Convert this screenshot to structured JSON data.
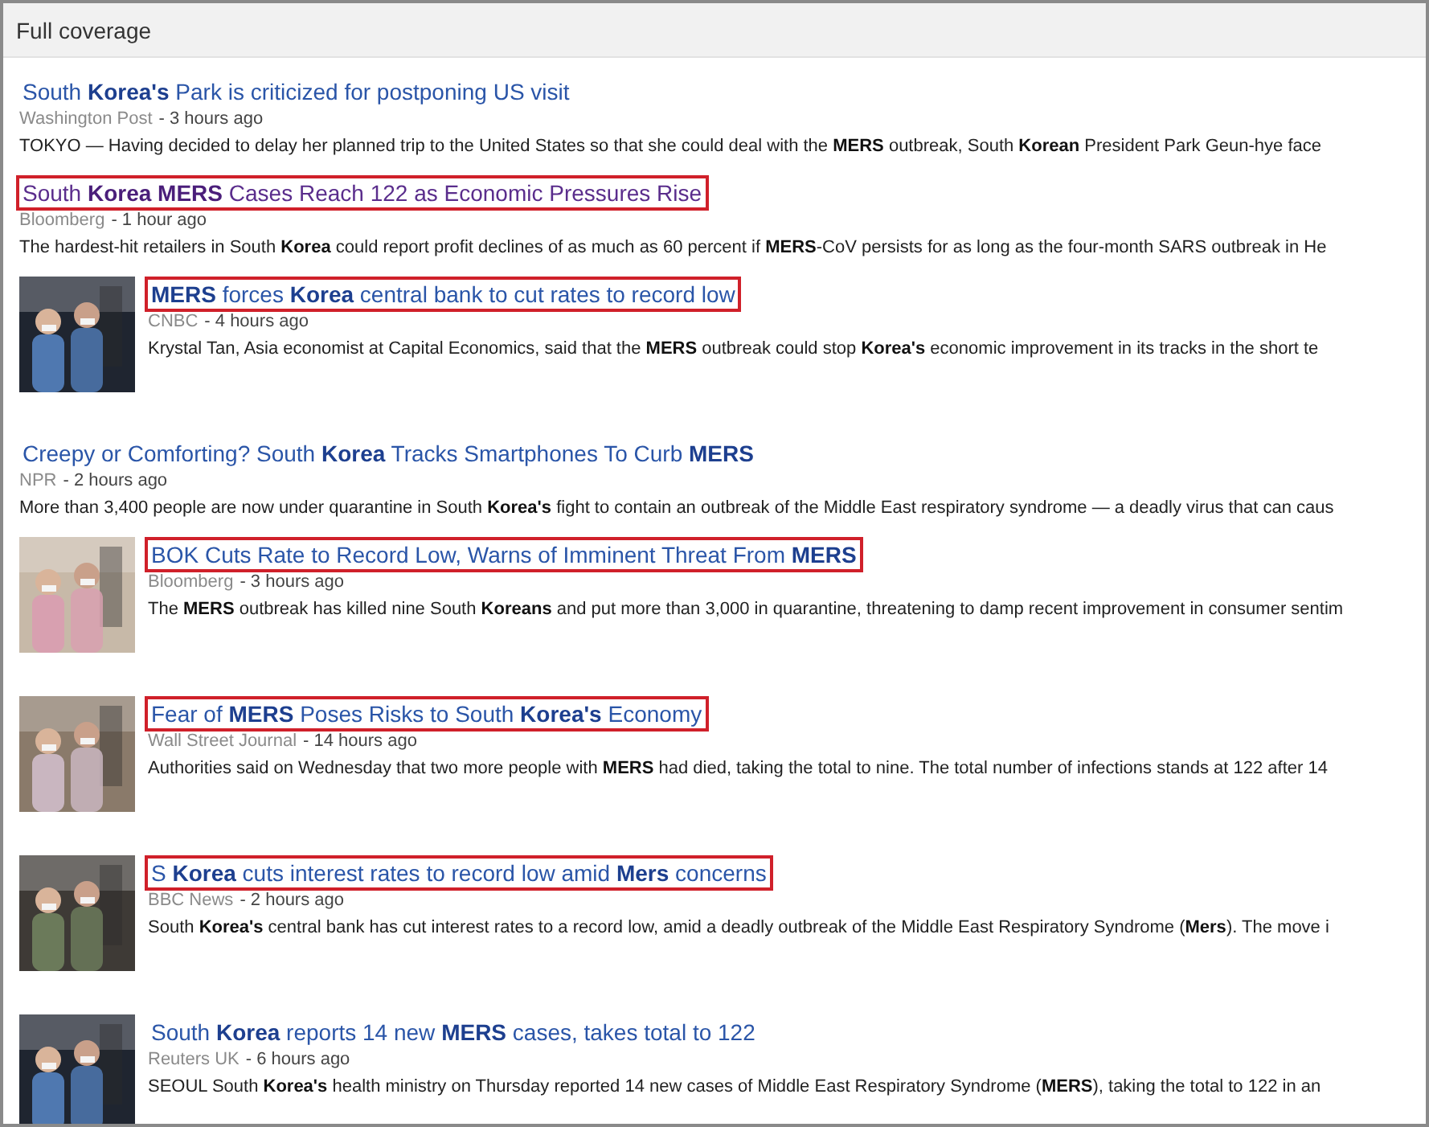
{
  "header": {
    "title": "Full coverage"
  },
  "articles": [
    {
      "kind": "plain",
      "title": "South **Korea's** Park is criticized for postponing US visit",
      "source": "Washington Post",
      "time": "- 3 hours ago",
      "snippet": "TOKYO — Having decided to delay her planned trip to the United States so that she could deal with the **MERS** outbreak, South **Korean** President Park Geun-hye face",
      "highlighted": false,
      "visited": false
    },
    {
      "kind": "plain",
      "title": "South **Korea MERS** Cases Reach 122 as Economic Pressures Rise",
      "source": "Bloomberg",
      "time": "- 1 hour ago",
      "snippet": "The hardest-hit retailers in South **Korea** could report profit declines of as much as 60 percent if **MERS**-CoV persists for as long as the four-month SARS outbreak in He",
      "highlighted": true,
      "visited": true
    },
    {
      "kind": "picture",
      "title": "**MERS** forces **Korea** central bank to cut rates to record low",
      "source": "CNBC",
      "time": "- 4 hours ago",
      "snippet": "Krystal Tan, Asia economist at Capital Economics, said that the **MERS** outbreak could stop **Korea's** economic improvement in its tracks in the short te",
      "highlighted": true,
      "visited": false
    },
    {
      "kind": "plain",
      "title": "Creepy or Comforting? South **Korea** Tracks Smartphones To Curb **MERS**",
      "source": "NPR",
      "time": "- 2 hours ago",
      "snippet": "More than 3,400 people are now under quarantine in South **Korea's** fight to contain an outbreak of the Middle East respiratory syndrome — a deadly virus that can caus",
      "highlighted": false,
      "visited": false
    },
    {
      "kind": "picture",
      "title": "BOK Cuts Rate to Record Low, Warns of Imminent Threat From **MERS**",
      "source": "Bloomberg",
      "time": "- 3 hours ago",
      "snippet": "The **MERS** outbreak has killed nine South **Koreans** and put more than 3,000 in quarantine, threatening to damp recent improvement in consumer sentim",
      "highlighted": true,
      "visited": false
    },
    {
      "kind": "picture",
      "title": "Fear of **MERS** Poses Risks to South **Korea's** Economy",
      "source": "Wall Street Journal",
      "time": "- 14 hours ago",
      "snippet": "Authorities said on Wednesday that two more people with **MERS** had died, taking the total to nine. The total number of infections stands at 122 after 14",
      "highlighted": true,
      "visited": false
    },
    {
      "kind": "picture",
      "title": "S **Korea** cuts interest rates to record low amid **Mers** concerns",
      "source": "BBC News",
      "time": "- 2 hours ago",
      "snippet": "South **Korea's** central bank has cut interest rates to a record low, amid a deadly outbreak of the Middle East Respiratory Syndrome (**Mers**). The move i",
      "highlighted": true,
      "visited": false
    },
    {
      "kind": "picture",
      "title": "South **Korea** reports 14 new **MERS** cases, takes total to 122",
      "source": "Reuters UK",
      "time": "- 6 hours ago",
      "snippet": "SEOUL South **Korea's** health ministry on Thursday reported 14 new cases of Middle East Respiratory Syndrome (**MERS**), taking the total to 122 in an",
      "highlighted": false,
      "visited": false
    }
  ]
}
